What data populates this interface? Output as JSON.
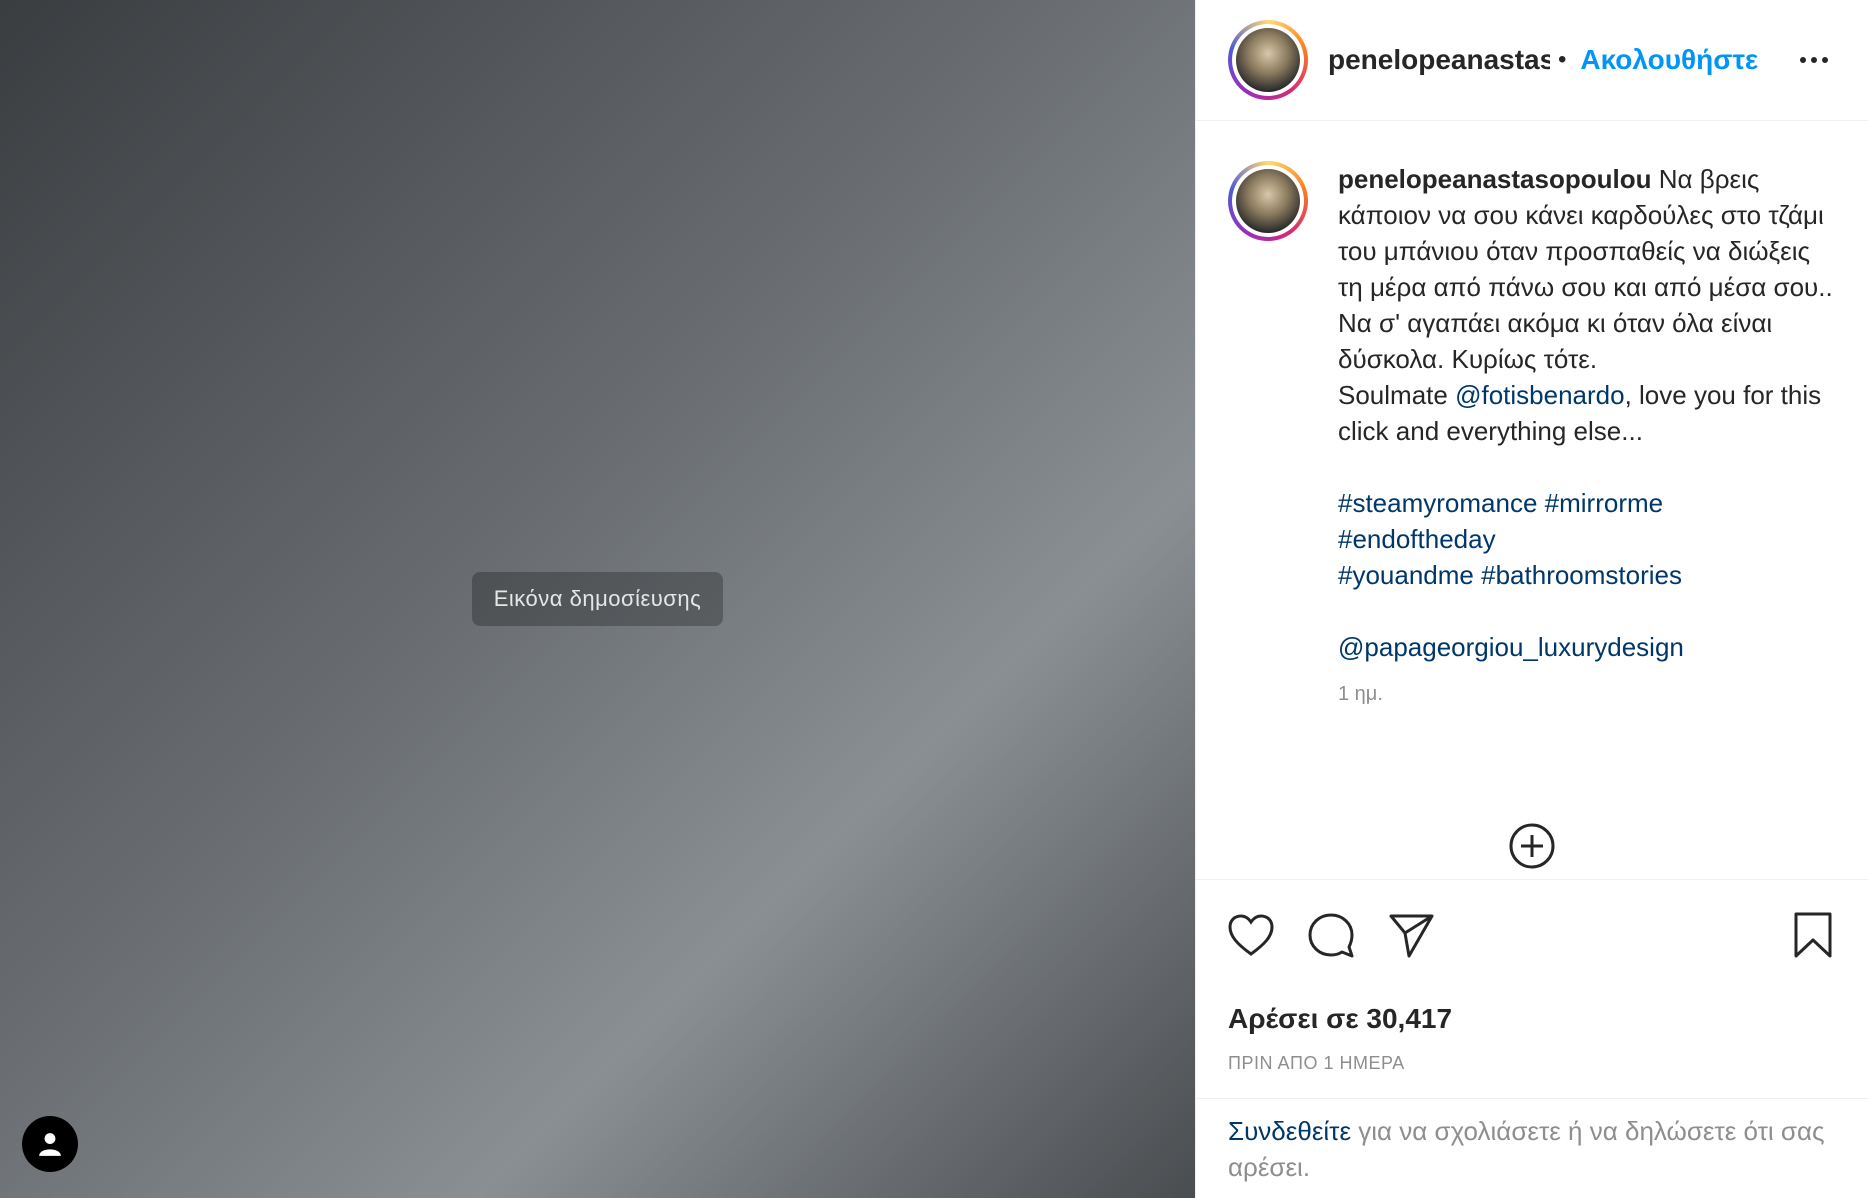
{
  "post_image": {
    "placeholder_label": "Εικόνα δημοσίευσης"
  },
  "header": {
    "username": "penelopeanastasopoulou",
    "separator": "•",
    "follow_label": "Ακολουθήστε"
  },
  "caption": {
    "username": "penelopeanastasopoulou",
    "text_1": "Να βρεις κάποιον να σου κάνει καρδούλες στο τζάμι του μπάνιου όταν προσπαθείς να διώξεις τη μέρα από πάνω σου και από μέσα σου..",
    "text_2": "Να σ' αγαπάει ακόμα κι όταν όλα είναι δύσκολα. Κυρίως τότε.",
    "text_3_prefix": "Soulmate ",
    "mention_1": "@fotisbenardo",
    "text_3_suffix": ", love you for this click and everything else...",
    "hashtag_1": "#steamyromance",
    "hashtag_2": "#mirrorme",
    "hashtag_3": "#endoftheday",
    "hashtag_4": "#youandme",
    "hashtag_5": "#bathroomstories",
    "mention_2": "@papageorgiou_luxurydesign",
    "time_ago": "1 ημ."
  },
  "actions": {
    "like_icon": "heart-icon",
    "comment_icon": "comment-icon",
    "share_icon": "paper-plane-icon",
    "save_icon": "bookmark-icon"
  },
  "likes": {
    "label": "Αρέσει σε 30,417"
  },
  "post_date": "ΠΡΙΝ ΑΠΟ 1 ΗΜΕΡΑ",
  "footer": {
    "login_link": "Συνδεθείτε",
    "login_rest": " για να σχολιάσετε ή να δηλώσετε ότι σας αρέσει."
  },
  "colors": {
    "link_blue": "#0095f6",
    "hashtag_blue": "#00376b",
    "muted": "#8e8e8e"
  }
}
